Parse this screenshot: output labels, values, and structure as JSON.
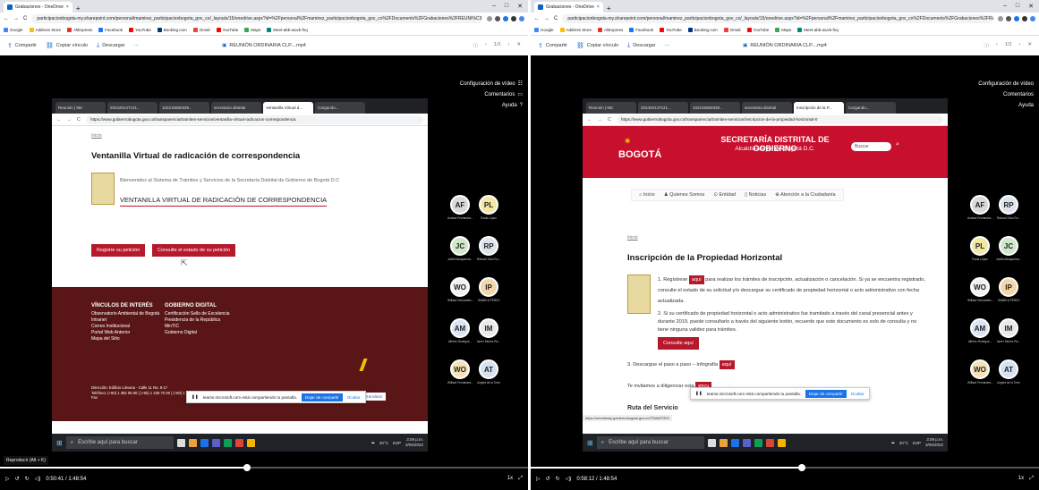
{
  "browser": {
    "tab_title": "Grabaciones - OneDrive",
    "url": "participacionbogota-my.sharepoint.com/personal/mamirez_participacionbogota_gov_co/_layouts/15/onedrive.aspx?id=%2Fpersonal%2Fmamirez_participacionbogota_gov_co%2FDocuments%2FGrabaciones%2FREUNI%C3%93N%20...",
    "url_short": "participacionbogota-my.sharepoint.com/personal/mamirez_participacionbogota_gov_co/_layouts/15/onedrive.aspx?id=%2Fpersonal%2Fmamirez_participacionbogota_gov_co%2FDocuments%2FGrabaciones%2FREUNI%C3%93N...",
    "bookmarks": [
      "Google",
      "Address Store",
      "AliExpress",
      "Facebook",
      "YouTube",
      "Booking.com",
      "Gmail",
      "YouTube",
      "Maps",
      "Meet-abb-wuvk-fnq"
    ]
  },
  "toolbar": {
    "share_label": "Compartir",
    "copy_link_label": "Copiar vínculo",
    "download_label": "Descargar",
    "more_label": "···",
    "file_name": "REUNIÓN ORDINARIA CLP....mp4",
    "file_name_right": "REUNIÓN ORDINARIA CLP....mp4",
    "page_counter": "1/1"
  },
  "side_menu": {
    "video_settings": "Configuración de vídeo",
    "comments": "Comentarios",
    "help": "Ayuda"
  },
  "left_video": {
    "inner_tabs": [
      "Reunión | Mic",
      "202420147121...",
      "102215550339...",
      "secretaria distrital",
      "Ventanilla Virtual d...",
      "Cargando..."
    ],
    "inner_url": "https://www.gobiernobogota.gov.co/transparencia/tramites-servicios/ventanilla-virtual-radicacion-correspondencia",
    "crumb": "Inicio",
    "heading": "Ventanilla Virtual de radicación de correspondencia",
    "welcome": "Bienvenidos al Sistema de Trámites y Servicios de la Secretaría Distrital de Gobierno de Bogotá D.C",
    "portal_title": "VENTANILLA VIRTUAL DE RADICACIÓN DE CORRESPONDENCIA",
    "btn_register": "Registre su petición",
    "btn_status": "Consulte el estado de su petición",
    "links_heading": "VÍNCULOS DE INTERÉS",
    "links": [
      "Observatorio Ambiental de Bogotá",
      "Intranet",
      "Correo Institucional",
      "Portal Web Anterior",
      "Mapa del Sitio"
    ],
    "gov_heading": "GOBIERNO DIGITAL",
    "gov_links": [
      "Certificación Sello de Excelencia",
      "Presidencia de la República",
      "MinTIC",
      "Gobierno Digital"
    ],
    "address": "Dirección: Edificio Liévano - Calle 11 No. 8-17",
    "phone": "Teléfono: (+60) 1 382 06 60 | (+60) 1 338 70 00 | (+60) 1 338 71 00",
    "fax": "Fax",
    "translator": "Use Website Translator",
    "share_msg": "teams.microsoft.com está compartiendo tu pantalla.",
    "share_stop": "Dejar de compartir",
    "share_hide": "Ocultar",
    "timestamp": "0:50:41 / 1:48:54",
    "progress": 0.467,
    "reproducir": "Reproducir (Alt + K)"
  },
  "right_video": {
    "inner_tabs": [
      "Reunión | Mic",
      "202420147121...",
      "102215550339...",
      "secretaria distrital",
      "Inscripción de la P...",
      "Cargando..."
    ],
    "inner_url": "https://www.gobiernobogota.gov.co/transparencia/tramites-servicios/inscripcion-de-la-propiedad-horizontal-0",
    "logo": "BOGOTÁ",
    "entity": "SECRETARÍA DISTRITAL DE GOBIERNO",
    "entity_sub": "Alcaldía Mayor de Bogotá D.C.",
    "search_placeholder": "Buscar",
    "nav": [
      "Inicio",
      "Quienes Somos",
      "Entidad",
      "Noticias",
      "Atención a la Ciudadanía"
    ],
    "crumb": "Inicio",
    "heading": "Inscripción de la Propiedad Horizontal",
    "step1_a": "1. Regístrese",
    "step1_btn": "aquí",
    "step1_b": "para realizar los trámites de inscripción, actualización o cancelación. Si ya se encuentra registrado, consulte el estado de su solicitud y/o descargue su certificado de propiedad horizontal o acto administrativo con fecha actualizada.",
    "step2": "2. Si su certificado de propiedad horizontal o acto administrativo fue tramitado a través del canal presencial antes y durante 2019, puede consultarlo a través del siguiente botón, recuerde que este documento es solo de consulta y no tiene ninguna validez para trámites.",
    "step2_btn": "Consulte aquí",
    "step3": "3. Descargue el paso a paso – Infografía",
    "step3_btn": "aquí",
    "invite": "Te invitamos a diligenciar esta",
    "invite_btn": "encu",
    "route": "Ruta del Servicio",
    "status_url": "https://memlesdy.gobiernobogota.gov.co/TRAMITES/",
    "timestamp": "0:58:12 / 1:48:54",
    "progress": 0.534
  },
  "taskbar": {
    "search_placeholder": "Escribe aquí para buscar",
    "weather": "20°C",
    "lang": "ESP",
    "time": "3:09 p.m.",
    "date": "3/05/2022"
  },
  "participants_left": [
    {
      "initials": "AF",
      "name": "Andrea Fernández...",
      "color": "#d9d9d9"
    },
    {
      "initials": "PL",
      "name": "Paula López",
      "color": "#f3e7a3"
    },
    {
      "initials": "JC",
      "name": "Judith Marquerina...",
      "color": "#cfe8c9"
    },
    {
      "initials": "RP",
      "name": "Richard Tobo Ru...",
      "color": "#dde4ee"
    },
    {
      "initials": "WO",
      "name": "William Hernández...",
      "color": "#f1f1f1"
    },
    {
      "initials": "IP",
      "name": "ISABELA PEREZ",
      "color": "#f5d6a8"
    },
    {
      "initials": "AM",
      "name": "Alfredo Rodrigue...",
      "color": "#dbe4f3"
    },
    {
      "initials": "IM",
      "name": "Ismer Muñoz Ra...",
      "color": "#e9e9e9"
    },
    {
      "initials": "WO",
      "name": "William Fernández...",
      "color": "#f6e0b5"
    },
    {
      "initials": "AT",
      "name": "Angela de la Torre",
      "color": "#d4e2f4"
    }
  ],
  "participants_right": [
    {
      "initials": "AF",
      "name": "Andrea Fernández...",
      "color": "#d9d9d9"
    },
    {
      "initials": "RP",
      "name": "Richard Tobo Ru...",
      "color": "#dde4ee"
    },
    {
      "initials": "PL",
      "name": "Paula López",
      "color": "#f3e7a3"
    },
    {
      "initials": "JC",
      "name": "Judith Marquerina...",
      "color": "#cfe8c9"
    },
    {
      "initials": "WO",
      "name": "William Hernández...",
      "color": "#f1f1f1"
    },
    {
      "initials": "IP",
      "name": "ISABELA PEREZ",
      "color": "#f5d6a8"
    },
    {
      "initials": "AM",
      "name": "Alfredo Rodrigue...",
      "color": "#dbe4f3"
    },
    {
      "initials": "IM",
      "name": "Ismer Muñoz Ra...",
      "color": "#e9e9e9"
    },
    {
      "initials": "WO",
      "name": "William Fernández...",
      "color": "#f6e0b5"
    },
    {
      "initials": "AT",
      "name": "Angela de la Torre",
      "color": "#d4e2f4"
    }
  ],
  "colors": {
    "accent_red": "#b5192b",
    "onedrive_blue": "#0a63c7",
    "footer_dark": "#5a1616"
  }
}
